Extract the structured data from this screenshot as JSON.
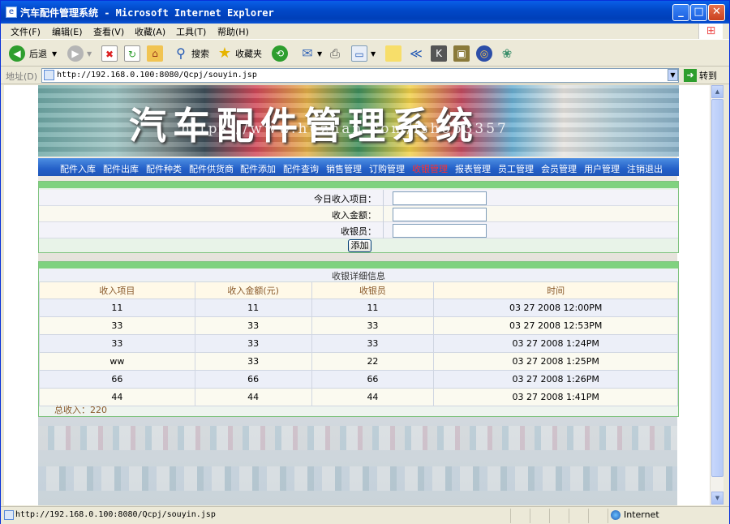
{
  "window": {
    "title": "汽车配件管理系统 - Microsoft Internet Explorer",
    "minimize": "_",
    "maximize": "□",
    "close": "✕"
  },
  "menu": [
    "文件(F)",
    "编辑(E)",
    "查看(V)",
    "收藏(A)",
    "工具(T)",
    "帮助(H)"
  ],
  "toolbar": {
    "back": "后退",
    "search": "搜索",
    "favorites": "收藏夹"
  },
  "address": {
    "label": "地址(D)",
    "url": "http://192.168.0.100:8080/Qcpj/souyin.jsp",
    "go": "转到"
  },
  "banner": {
    "title": "汽车配件管理系统",
    "watermark": "https://www.huzhan.com/ishop3357"
  },
  "nav": [
    {
      "label": "配件入库",
      "active": false
    },
    {
      "label": "配件出库",
      "active": false
    },
    {
      "label": "配件种类",
      "active": false
    },
    {
      "label": "配件供货商",
      "active": false
    },
    {
      "label": "配件添加",
      "active": false
    },
    {
      "label": "配件查询",
      "active": false
    },
    {
      "label": "销售管理",
      "active": false
    },
    {
      "label": "订购管理",
      "active": false
    },
    {
      "label": "收银管理",
      "active": true
    },
    {
      "label": "报表管理",
      "active": false
    },
    {
      "label": "员工管理",
      "active": false
    },
    {
      "label": "会员管理",
      "active": false
    },
    {
      "label": "用户管理",
      "active": false
    },
    {
      "label": "注销退出",
      "active": false
    }
  ],
  "form": {
    "item_label": "今日收入项目：",
    "amount_label": "收入金额：",
    "cashier_label": "收银员：",
    "item_value": "",
    "amount_value": "",
    "cashier_value": "",
    "add_button": "添加"
  },
  "records": {
    "title": "收银详细信息",
    "columns": [
      "收入项目",
      "收入金额(元)",
      "收银员",
      "时间"
    ],
    "rows": [
      [
        "11",
        "11",
        "11",
        "03 27 2008 12:00PM"
      ],
      [
        "33",
        "33",
        "33",
        "03 27 2008 12:53PM"
      ],
      [
        "33",
        "33",
        "33",
        "03 27 2008 1:24PM"
      ],
      [
        "ww",
        "33",
        "22",
        "03 27 2008 1:25PM"
      ],
      [
        "66",
        "66",
        "66",
        "03 27 2008 1:26PM"
      ],
      [
        "44",
        "44",
        "44",
        "03 27 2008 1:41PM"
      ]
    ],
    "total": "总收入：220"
  },
  "status": {
    "url": "http://192.168.0.100:8080/Qcpj/souyin.jsp",
    "zone": "Internet"
  },
  "colors": {
    "nav_bg": "#2460c8",
    "nav_active": "#ff3030",
    "panel_bar": "#7fd27f",
    "header_text": "#8a5a2b"
  }
}
